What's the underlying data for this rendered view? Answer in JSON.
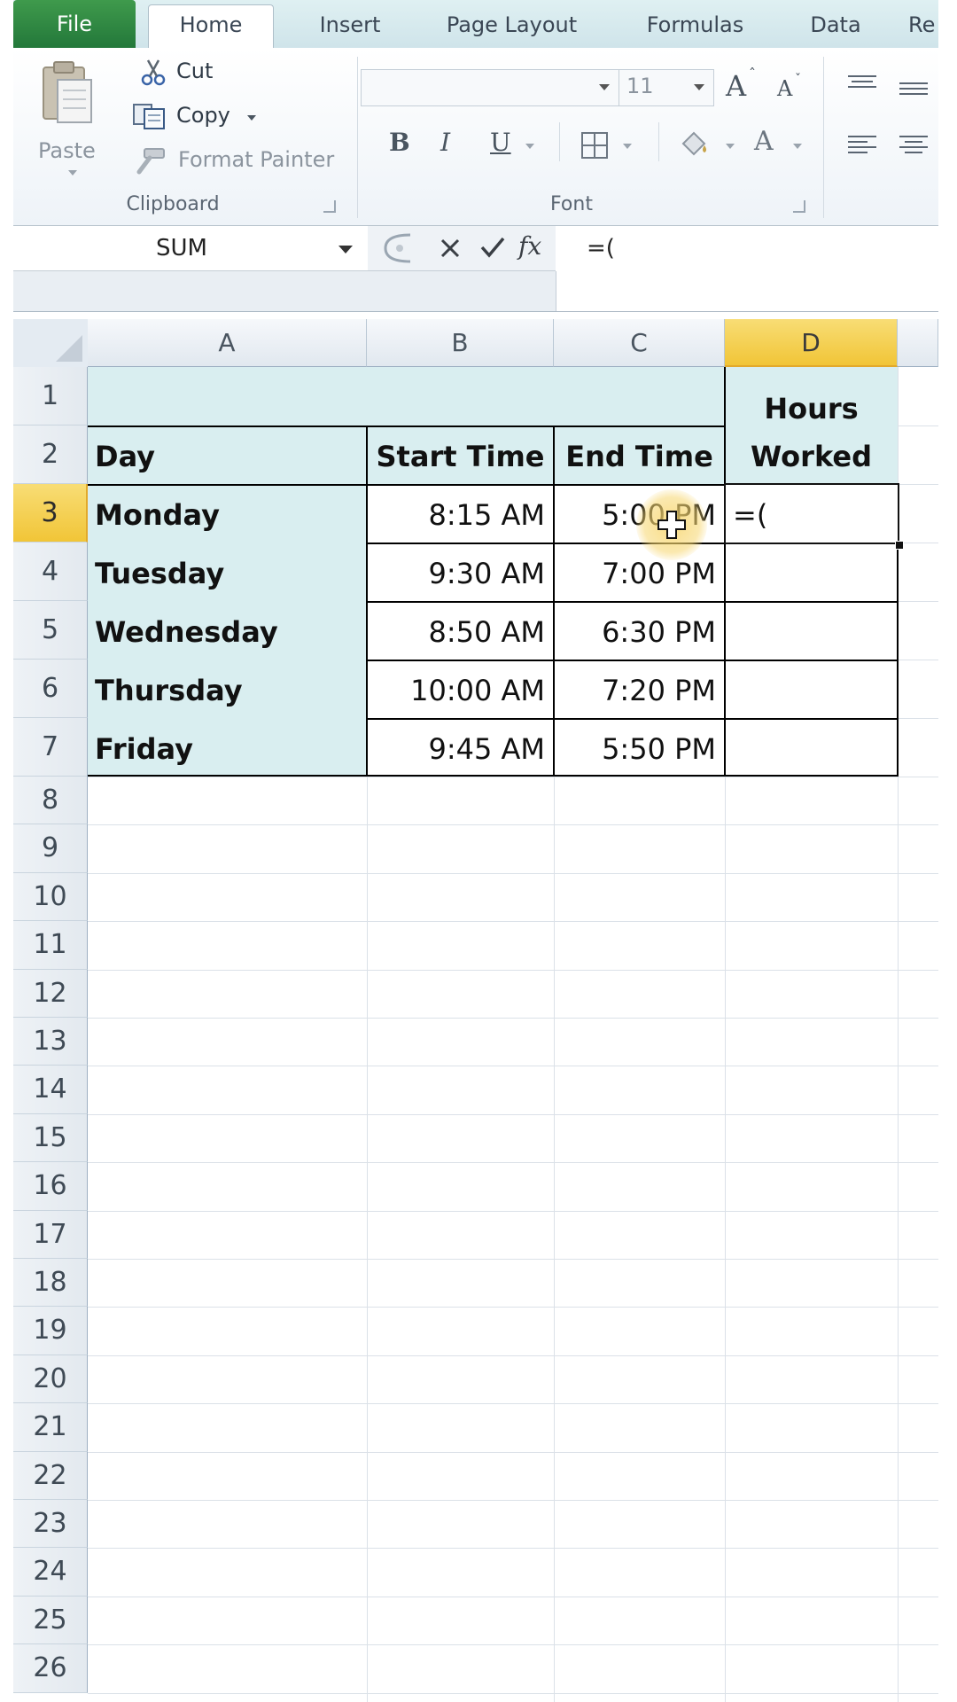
{
  "ribbon": {
    "tabs": {
      "file": "File",
      "home": "Home",
      "insert": "Insert",
      "page_layout": "Page Layout",
      "formulas": "Formulas",
      "data": "Data",
      "review_partial": "Re"
    },
    "clipboard": {
      "paste": "Paste",
      "cut": "Cut",
      "copy": "Copy",
      "format_painter": "Format Painter",
      "group_label": "Clipboard"
    },
    "font": {
      "name_value": "",
      "size_value": "11",
      "bold": "B",
      "italic": "I",
      "underline": "U",
      "grow": "A",
      "shrink": "A",
      "font_color": "A",
      "group_label": "Font"
    }
  },
  "formula_bar": {
    "name_box": "SUM",
    "fx": "fx",
    "content": "=("
  },
  "sheet": {
    "columns": [
      "A",
      "B",
      "C",
      "D"
    ],
    "selected_column": "D",
    "selected_row": "3",
    "rows": [
      "1",
      "2",
      "3",
      "4",
      "5",
      "6",
      "7",
      "8",
      "9",
      "10",
      "11",
      "12",
      "13",
      "14",
      "15",
      "16",
      "17",
      "18",
      "19",
      "20",
      "21",
      "22",
      "23",
      "24",
      "25",
      "26"
    ],
    "headers": {
      "day": "Day",
      "start": "Start Time",
      "end": "End Time",
      "hours_line1": "Hours",
      "hours_line2": "Worked"
    },
    "data": [
      {
        "day": "Monday",
        "start": "8:15 AM",
        "end": "5:00 PM",
        "hours": "=("
      },
      {
        "day": "Tuesday",
        "start": "9:30 AM",
        "end": "7:00 PM",
        "hours": ""
      },
      {
        "day": "Wednesday",
        "start": "8:50 AM",
        "end": "6:30 PM",
        "hours": ""
      },
      {
        "day": "Thursday",
        "start": "10:00 AM",
        "end": "7:20 PM",
        "hours": ""
      },
      {
        "day": "Friday",
        "start": "9:45 AM",
        "end": "5:50 PM",
        "hours": ""
      }
    ]
  },
  "colors": {
    "header_fill": "#d9eef0",
    "selection_header": "#f1c537",
    "file_tab": "#2a7f3f"
  }
}
